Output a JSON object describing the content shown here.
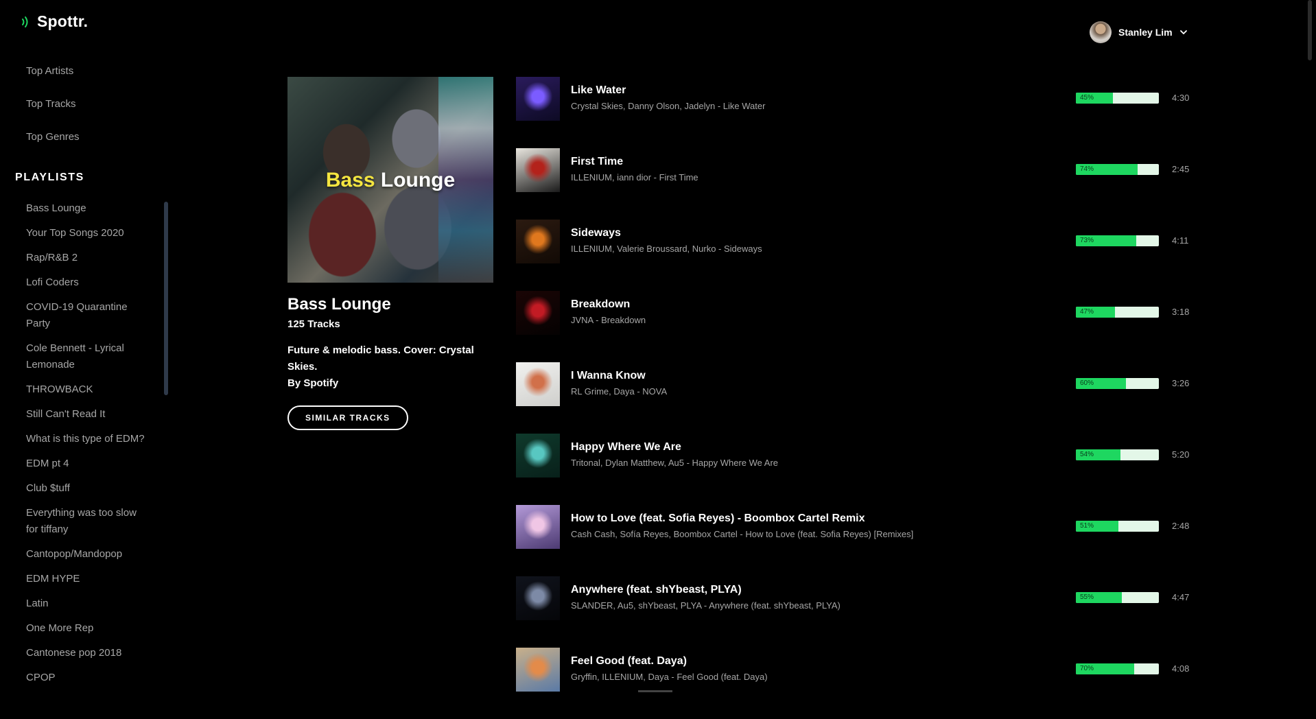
{
  "app": {
    "logo": "Spottr."
  },
  "nav": [
    "Top Artists",
    "Top Tracks",
    "Top Genres"
  ],
  "playlists": {
    "heading": "PLAYLISTS",
    "items": [
      "Bass Lounge",
      "Your Top Songs 2020",
      "Rap/R&B 2",
      "Lofi Coders",
      "COVID-19 Quarantine Party",
      "Cole Bennett - Lyrical Lemonade",
      "THROWBACK",
      "Still Can't Read It",
      "What is this type of EDM?",
      "EDM pt 4",
      "Club $tuff",
      "Everything was too slow for tiffany",
      "Cantopop/Mandopop",
      "EDM HYPE",
      "Latin",
      "One More Rep",
      "Cantonese pop 2018",
      "CPOP"
    ]
  },
  "user": {
    "name": "Stanley Lim"
  },
  "playlist": {
    "cover_word1": "Bass",
    "cover_word2": "Lounge",
    "name": "Bass Lounge",
    "track_count": "125 Tracks",
    "description": "Future & melodic bass. Cover: Crystal Skies.",
    "owner": "By Spotify",
    "similar_label": "SIMILAR TRACKS"
  },
  "tracks": [
    {
      "title": "Like Water",
      "artists": "Crystal Skies, Danny Olson, Jadelyn - Like Water",
      "popularity": 45,
      "popularity_label": "45%",
      "duration": "4:30",
      "art": [
        "#2a1b5c",
        "#7b5cff",
        "#0d0a24"
      ]
    },
    {
      "title": "First Time",
      "artists": "ILLENIUM, iann dior - First Time",
      "popularity": 74,
      "popularity_label": "74%",
      "duration": "2:45",
      "art": [
        "#e9e6df",
        "#b3221b",
        "#1a1a1a"
      ]
    },
    {
      "title": "Sideways",
      "artists": "ILLENIUM, Valerie Broussard, Nurko - Sideways",
      "popularity": 73,
      "popularity_label": "73%",
      "duration": "4:11",
      "art": [
        "#2b1a10",
        "#e0781e",
        "#120a05"
      ]
    },
    {
      "title": "Breakdown",
      "artists": "JVNA - Breakdown",
      "popularity": 47,
      "popularity_label": "47%",
      "duration": "3:18",
      "art": [
        "#1a0505",
        "#c21b24",
        "#050202"
      ]
    },
    {
      "title": "I Wanna Know",
      "artists": "RL Grime, Daya - NOVA",
      "popularity": 60,
      "popularity_label": "60%",
      "duration": "3:26",
      "art": [
        "#f1f1ef",
        "#d1704a",
        "#cfcfcc"
      ]
    },
    {
      "title": "Happy Where We Are",
      "artists": "Tritonal, Dylan Matthew, Au5 - Happy Where We Are",
      "popularity": 54,
      "popularity_label": "54%",
      "duration": "5:20",
      "art": [
        "#0f3a2c",
        "#58c7c1",
        "#08201a"
      ]
    },
    {
      "title": "How to Love (feat. Sofia Reyes) - Boombox Cartel Remix",
      "artists": "Cash Cash, Sofía Reyes, Boombox Cartel - How to Love (feat. Sofia Reyes) [Remixes]",
      "popularity": 51,
      "popularity_label": "51%",
      "duration": "2:48",
      "art": [
        "#b49ad8",
        "#f0c6e5",
        "#4c3a72"
      ]
    },
    {
      "title": "Anywhere (feat. shYbeast, PLYA)",
      "artists": "SLANDER, Au5, shYbeast, PLYA - Anywhere (feat. shYbeast, PLYA)",
      "popularity": 55,
      "popularity_label": "55%",
      "duration": "4:47",
      "art": [
        "#10131c",
        "#7d8aa6",
        "#050609"
      ]
    },
    {
      "title": "Feel Good (feat. Daya)",
      "artists": "Gryffin, ILLENIUM, Daya - Feel Good (feat. Daya)",
      "popularity": 70,
      "popularity_label": "70%",
      "duration": "4:08",
      "art": [
        "#c9b08a",
        "#e38b4a",
        "#5a7aa6"
      ]
    }
  ],
  "colors": {
    "accent": "#1ed760",
    "bar_track": "#e3f7e8",
    "muted_text": "#a7a7a7"
  }
}
